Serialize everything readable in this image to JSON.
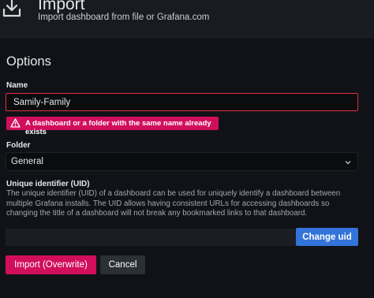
{
  "header": {
    "title": "Import",
    "subtitle": "Import dashboard from file or Grafana.com",
    "icon": "download-icon"
  },
  "options": {
    "title": "Options",
    "name_label": "Name",
    "name_value": "Samily-Family",
    "name_error": "A dashboard or a folder with the same name already exists",
    "folder_label": "Folder",
    "folder_value": "General",
    "uid_label": "Unique identifier (UID)",
    "uid_description": "The unique identifier (UID) of a dashboard can be used for uniquely identify a dashboard between multiple Grafana installs. The UID allows having consistent URLs for accessing dashboards so changing the title of a dashboard will not break any bookmarked links to that dashboard.",
    "uid_value": "",
    "change_uid_label": "Change uid"
  },
  "actions": {
    "import_label": "Import (Overwrite)",
    "cancel_label": "Cancel"
  },
  "colors": {
    "background": "#111217",
    "error": "#d10e5c",
    "primary": "#3274d9"
  }
}
